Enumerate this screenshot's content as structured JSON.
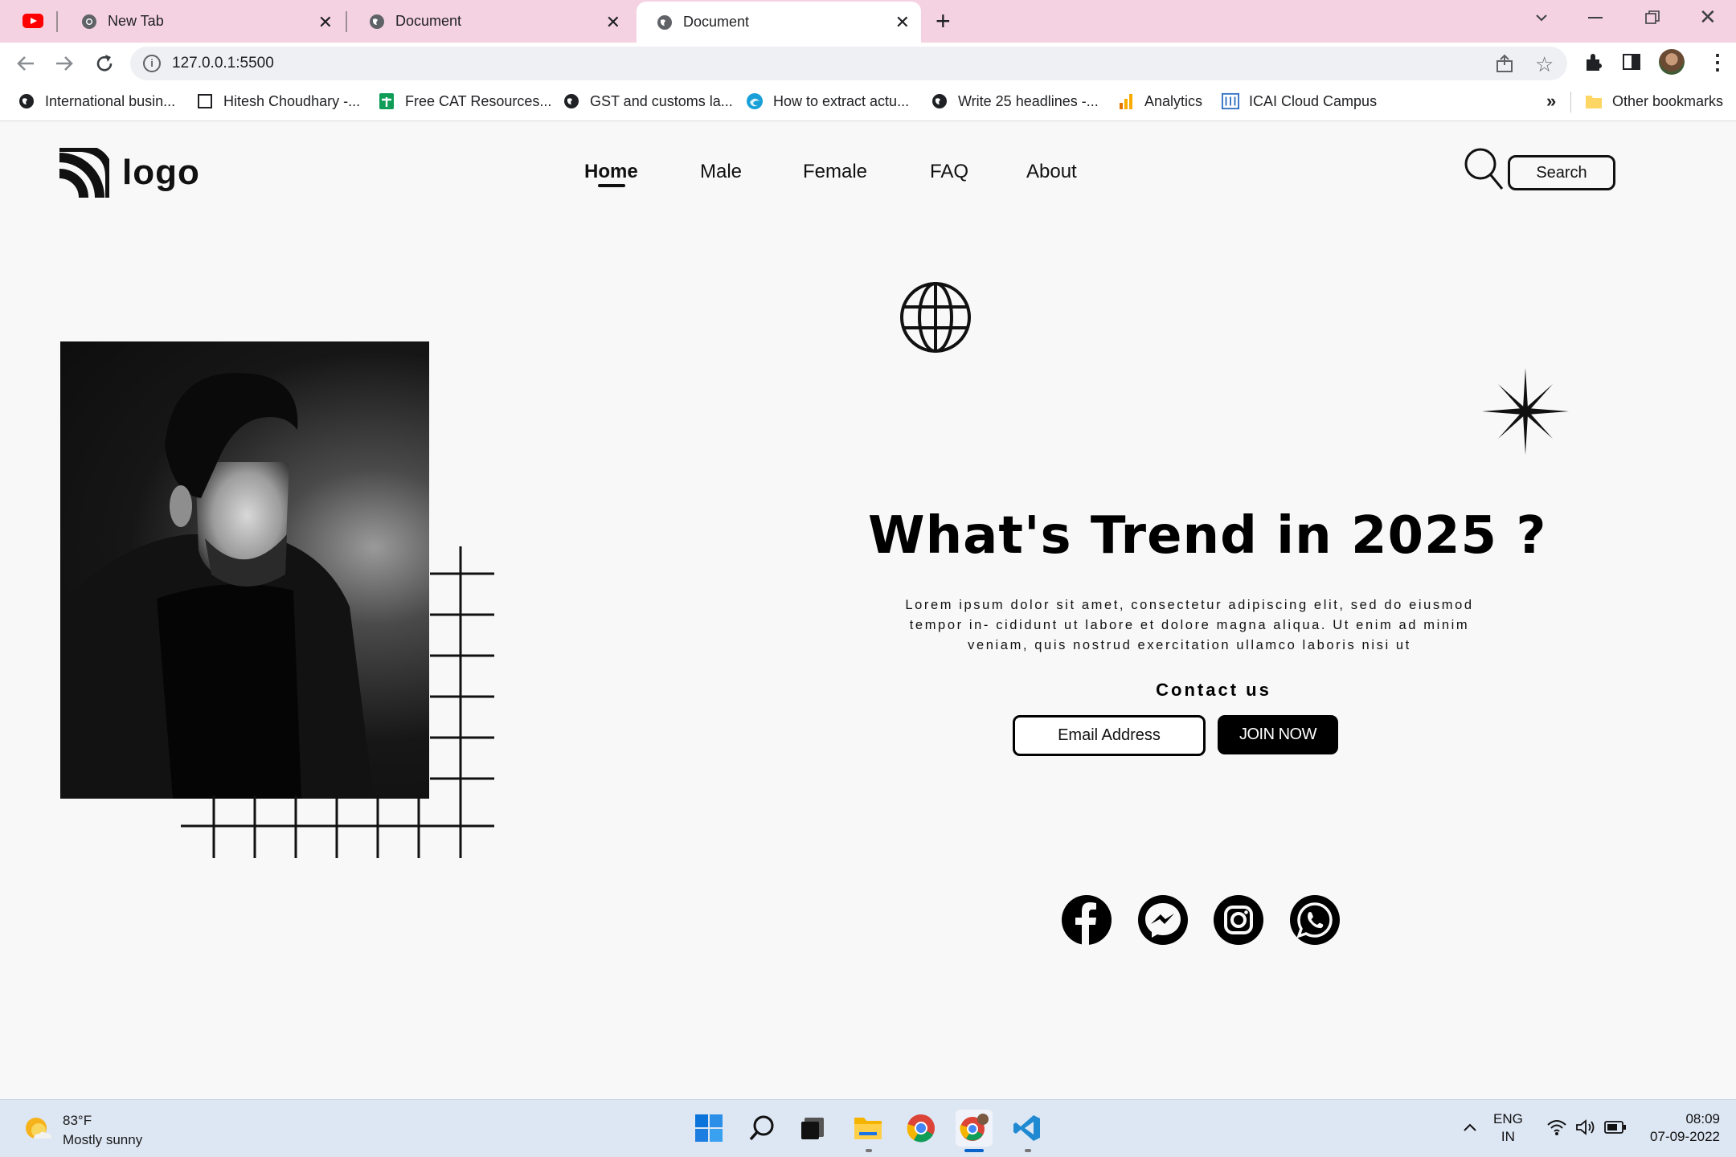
{
  "browser": {
    "tabs": [
      {
        "title": "New Tab",
        "icon": "chrome-icon"
      },
      {
        "title": "Document",
        "icon": "globe-icon"
      },
      {
        "title": "Document",
        "icon": "globe-icon",
        "active": true
      }
    ],
    "url": "127.0.0.1:5500",
    "bookmarks": [
      "International busin...",
      "Hitesh Choudhary -...",
      "Free CAT Resources...",
      "GST and customs la...",
      "How to extract actu...",
      "Write 25 headlines -...",
      "Analytics",
      "ICAI Cloud Campus"
    ],
    "more_bookmarks": "»",
    "other_bookmarks": "Other bookmarks"
  },
  "site": {
    "logo_text": "logo",
    "nav": [
      "Home",
      "Male",
      "Female",
      "FAQ",
      "About"
    ],
    "active_nav": "Home",
    "search_label": "Search",
    "hero_title": "What's Trend in 2025 ?",
    "hero_text_1": "Lorem ipsum dolor sit amet, consectetur adipiscing elit, sed do eiusmod",
    "hero_text_2": "tempor in- cididunt ut labore et dolore magna aliqua. Ut enim ad minim",
    "hero_text_3": "veniam, quis nostrud exercitation ullamco laboris nisi ut",
    "contact_heading": "Contact us",
    "email_placeholder": "Email Address",
    "join_label": "JOIN NOW",
    "social": [
      "facebook-icon",
      "messenger-icon",
      "instagram-icon",
      "whatsapp-icon"
    ]
  },
  "taskbar": {
    "temperature": "83°F",
    "weather": "Mostly sunny",
    "lang_1": "ENG",
    "lang_2": "IN",
    "time": "08:09",
    "date": "07-09-2022"
  },
  "colors": {
    "tabstrip": "#f5d2e1",
    "accent": "#000000",
    "page_bg": "#f8f8f8",
    "taskbar": "#dde6f3"
  }
}
